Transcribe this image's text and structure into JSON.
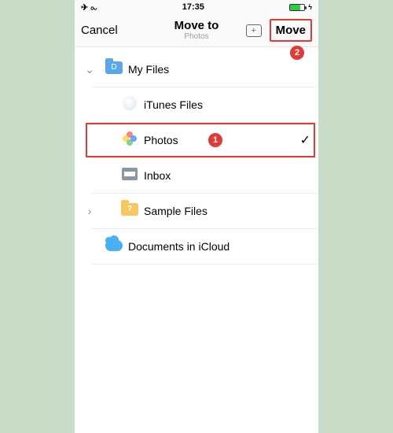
{
  "statusbar": {
    "time": "17:35"
  },
  "nav": {
    "cancel": "Cancel",
    "title": "Move to",
    "subtitle": "Photos",
    "move": "Move"
  },
  "annotations": {
    "badge1": "1",
    "badge2": "2"
  },
  "rows": {
    "myfiles": {
      "label": "My Files",
      "letter": "D"
    },
    "itunes": {
      "label": "iTunes Files"
    },
    "photos": {
      "label": "Photos"
    },
    "inbox": {
      "label": "Inbox"
    },
    "sample": {
      "label": "Sample Files",
      "mark": "?"
    },
    "icloud": {
      "label": "Documents in iCloud"
    }
  }
}
